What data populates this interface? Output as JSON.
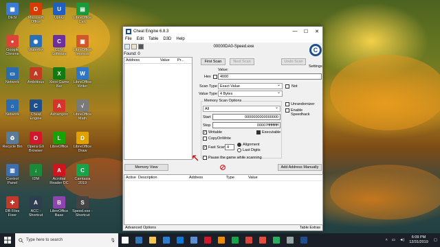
{
  "desktop_icons": [
    {
      "label": "DESI",
      "color": "#3a7bd5",
      "glyph": "▦"
    },
    {
      "label": "Microsoft Office",
      "color": "#d83b01",
      "glyph": "O"
    },
    {
      "label": "Uplay",
      "color": "#1f5fbf",
      "glyph": "U"
    },
    {
      "label": "LibreOffice Calc",
      "color": "#1a9a3a",
      "glyph": "▤"
    },
    {
      "label": "Google Chrome",
      "color": "#db4437",
      "glyph": "●"
    },
    {
      "label": "Waterfox",
      "color": "#2a6fb7",
      "glyph": "◉"
    },
    {
      "label": "CDM Software",
      "color": "#6b2fa0",
      "glyph": "C"
    },
    {
      "label": "LibreOffice Impress",
      "color": "#d0582a",
      "glyph": "▣"
    },
    {
      "label": "Network",
      "color": "#2b6cb0",
      "glyph": "▭"
    },
    {
      "label": "Ambitious",
      "color": "#c23b22",
      "glyph": "A"
    },
    {
      "label": "Xbox Game Bar",
      "color": "#107c10",
      "glyph": "X"
    },
    {
      "label": "LibreOffice Writer",
      "color": "#2f76c5",
      "glyph": "W"
    },
    {
      "label": "Network",
      "color": "#2b6cb0",
      "glyph": "⌂"
    },
    {
      "label": "Cheat Engine",
      "color": "#1e4e8c",
      "glyph": "C"
    },
    {
      "label": "Ashampoo",
      "color": "#d6352b",
      "glyph": "A"
    },
    {
      "label": "LibreOffice Math",
      "color": "#7a7a7a",
      "glyph": "√"
    },
    {
      "label": "Recycle Bin",
      "color": "#5b7c99",
      "glyph": "♻"
    },
    {
      "label": "Opera GX Browser",
      "color": "#d3162c",
      "glyph": "O"
    },
    {
      "label": "LibreOffice",
      "color": "#18a303",
      "glyph": "L"
    },
    {
      "label": "LibreOffice Draw",
      "color": "#e0a000",
      "glyph": "D"
    },
    {
      "label": "Control Panel",
      "color": "#3b6fb0",
      "glyph": "▥"
    },
    {
      "label": "IDM",
      "color": "#1a8a3a",
      "glyph": "↓"
    },
    {
      "label": "Acrobat Reader DC",
      "color": "#d0131f",
      "glyph": "A"
    },
    {
      "label": "Camtasia 2019",
      "color": "#17a34a",
      "glyph": "C"
    },
    {
      "label": "DB Files Fixer",
      "color": "#c0392b",
      "glyph": "✚"
    },
    {
      "label": "ACC - Shortcut",
      "color": "#2c3e50",
      "glyph": "A"
    },
    {
      "label": "LibreOffice Base",
      "color": "#8e44ad",
      "glyph": "B"
    },
    {
      "label": "Speed.exe - Shortcut",
      "color": "#444",
      "glyph": "S"
    }
  ],
  "window": {
    "title": "Cheat Engine 6.8.3",
    "controls": {
      "minimize": "—",
      "maximize": "☐",
      "close": "✕"
    },
    "menu": [
      "File",
      "Edit",
      "Table",
      "D3D",
      "Help"
    ],
    "process": "00000DA0-Speed.exe",
    "found": "Found: 0",
    "list_headers": [
      "Address",
      "Value",
      "Pr..."
    ],
    "buttons": {
      "first_scan": "First Scan",
      "next_scan": "Next Scan",
      "undo_scan": "Undo Scan",
      "memory_view": "Memory View",
      "add_address": "Add Address Manually"
    },
    "settings_label": "Settings",
    "value_label": "Value:",
    "hex_label": "Hex",
    "value_input": "4000",
    "scan_type_label": "Scan Type",
    "scan_type": "Exact Value",
    "value_type_label": "Value Type",
    "value_type": "4 Bytes",
    "not_label": "Not",
    "memory_scan_options": "Memory Scan Options",
    "region": "All",
    "start_label": "Start",
    "start_value": "0000000000000000",
    "stop_label": "Stop",
    "stop_value": "00007fffffffffff",
    "writable": "Writable",
    "executable": "Executable",
    "copyonwrite": "CopyOnWrite",
    "fast_scan": "Fast Scan",
    "fast_scan_value": "4",
    "alignment": "Alignment",
    "last_digits": "Last Digits",
    "pause_game": "Pause the game while scanning",
    "unrandomizer": "Unrandomizer",
    "enable_speedhack": "Enable Speedhack",
    "table_headers": [
      "Active",
      "Description",
      "Address",
      "Type",
      "Value"
    ],
    "advanced_options": "Advanced Options",
    "table_extras": "Table Extras"
  },
  "taskbar": {
    "search_placeholder": "Type here to search",
    "apps": [
      {
        "name": "task-view",
        "color": "#ffffff"
      },
      {
        "name": "edge",
        "color": "#3277bc"
      },
      {
        "name": "file-explorer",
        "color": "#f2c94c"
      },
      {
        "name": "store",
        "color": "#2d7dd2"
      },
      {
        "name": "mail",
        "color": "#0f78d4"
      },
      {
        "name": "photos",
        "color": "#5a8fd8"
      },
      {
        "name": "opera",
        "color": "#d3162c"
      },
      {
        "name": "vlc",
        "color": "#f08a00"
      },
      {
        "name": "camtasia",
        "color": "#17a34a"
      },
      {
        "name": "chrome",
        "color": "#db4437"
      },
      {
        "name": "camtasia-recorder",
        "color": "#e74c3c"
      },
      {
        "name": "app-green",
        "color": "#27ae60"
      },
      {
        "name": "app-gray",
        "color": "#95a5a6"
      },
      {
        "name": "cheat-engine",
        "color": "#1e4e8c"
      }
    ],
    "time": "6:09 PM",
    "date": "12/31/2019"
  }
}
